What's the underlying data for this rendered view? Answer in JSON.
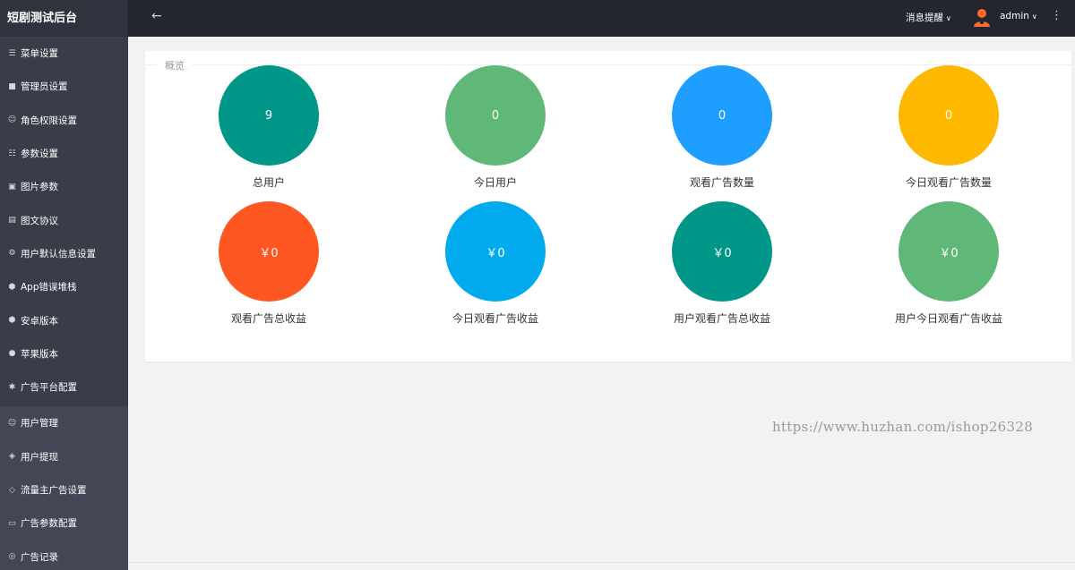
{
  "brand": "短剧测试后台",
  "menu_primary": [
    {
      "label": "菜单设置",
      "icon": "list-icon"
    },
    {
      "label": "管理员设置",
      "icon": "windows-icon"
    },
    {
      "label": "角色权限设置",
      "icon": "user-outline-icon"
    },
    {
      "label": "参数设置",
      "icon": "grid-icon"
    },
    {
      "label": "图片参数",
      "icon": "image-icon"
    },
    {
      "label": "图文协议",
      "icon": "document-icon"
    },
    {
      "label": "用户默认信息设置",
      "icon": "settings-gear-icon"
    },
    {
      "label": "App错误堆栈",
      "icon": "android-icon"
    },
    {
      "label": "安卓版本",
      "icon": "android-icon"
    },
    {
      "label": "苹果版本",
      "icon": "apple-icon"
    },
    {
      "label": "广告平台配置",
      "icon": "gear-icon"
    }
  ],
  "menu_secondary": [
    {
      "label": "用户管理",
      "icon": "user-outline-icon"
    },
    {
      "label": "用户提现",
      "icon": "shield-icon"
    },
    {
      "label": "流量主广告设置",
      "icon": "diamond-icon"
    },
    {
      "label": "广告参数配置",
      "icon": "card-icon"
    },
    {
      "label": "广告记录",
      "icon": "record-icon"
    }
  ],
  "header": {
    "back_icon": "arrow-left-icon",
    "notice": "消息提醒",
    "username": "admin"
  },
  "overview": {
    "legend": "概览",
    "stats": [
      {
        "value": "9",
        "label": "总用户",
        "color": "#009688"
      },
      {
        "value": "0",
        "label": "今日用户",
        "color": "#5fb878"
      },
      {
        "value": "0",
        "label": "观看广告数量",
        "color": "#1e9fff"
      },
      {
        "value": "0",
        "label": "今日观看广告数量",
        "color": "#ffb800"
      },
      {
        "value": "￥0",
        "label": "观看广告总收益",
        "color": "#ff5722"
      },
      {
        "value": "￥0",
        "label": "今日观看广告收益",
        "color": "#01aaed"
      },
      {
        "value": "￥0",
        "label": "用户观看广告总收益",
        "color": "#009688"
      },
      {
        "value": "￥0",
        "label": "用户今日观看广告收益",
        "color": "#5fb878"
      }
    ]
  },
  "watermark": "https://www.huzhan.com/ishop26328"
}
